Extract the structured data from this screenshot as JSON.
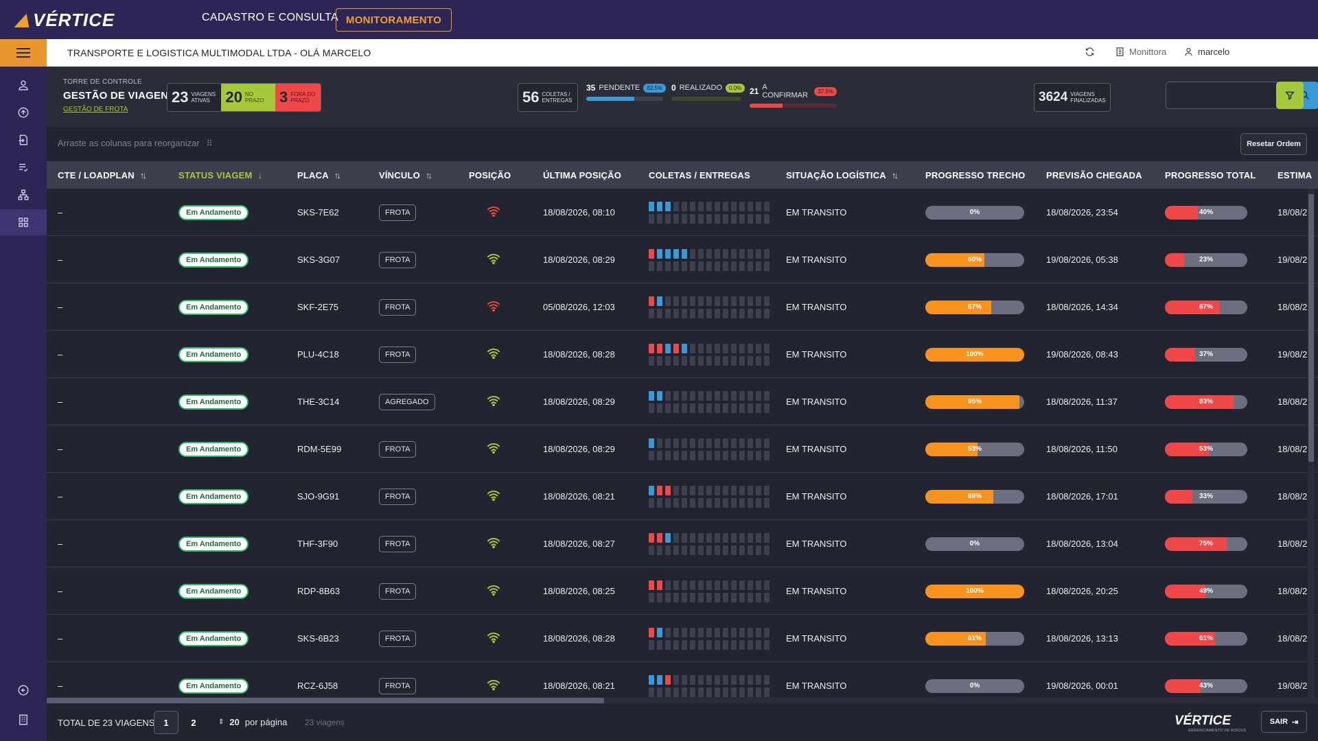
{
  "app": {
    "logo": "VÉRTICE",
    "nav_cadastro": "CADASTRO E CONSULTA",
    "nav_monitoramento": "MONITORAMENTO",
    "company_line": "TRANSPORTE E LOGISTICA MULTIMODAL LTDA - OLÁ MARCELO",
    "monittora": "Monittora",
    "user": "marcelo",
    "footer_logo": "VÉRTICE",
    "footer_logo_sub": "GERENCIAMENTO DE RISCOS"
  },
  "header": {
    "tower_small": "TORRE DE CONTROLE",
    "tower_title": "GESTÃO DE VIAGENS",
    "tower_link": "GESTÃO DE FROTA"
  },
  "kpis": {
    "ativas_num": "23",
    "ativas_lbl": "VIAGENS ATIVAS",
    "prazo_num": "20",
    "prazo_lbl": "NO PRAZO",
    "fora_num": "3",
    "fora_lbl": "FORA DO PRAZO",
    "coletas_num": "56",
    "coletas_lbl": "COLETAS / ENTREGAS",
    "pendente_num": "35",
    "pendente_lbl": "PENDENTE",
    "pendente_pct": "62.5%",
    "pendente_frac": 0.625,
    "realizado_num": "0",
    "realizado_lbl": "REALIZADO",
    "realizado_pct": "0.0%",
    "realizado_frac": 0,
    "confirmar_num": "21",
    "confirmar_lbl": "A CONFIRMAR",
    "confirmar_pct": "37.5%",
    "confirmar_frac": 0.375,
    "finalizadas_num": "3624",
    "finalizadas_lbl": "VIAGENS FINALIZADAS"
  },
  "toolbar": {
    "hint": "Arraste as colunas para reorganizar",
    "reset": "Resetar Ordem"
  },
  "columns": {
    "cte": "CTE / LOADPLAN",
    "status": "STATUS VIAGEM",
    "placa": "PLACA",
    "vinculo": "VÍNCULO",
    "posicao": "POSIÇÃO",
    "ultima": "ÚLTIMA POSIÇÃO",
    "coletas": "COLETAS / ENTREGAS",
    "situacao": "SITUAÇÃO LOGÍSTICA",
    "trecho": "PROGRESSO TRECHO",
    "previsao": "PREVISÃO CHEGADA",
    "total": "PROGRESSO TOTAL",
    "estima": "ESTIMA"
  },
  "colors": {
    "orange": "#f7931e",
    "red": "#f04848",
    "blue": "#3a9ad9",
    "green_wifi": "#a5c93a",
    "red_wifi": "#e8483f"
  },
  "rows": [
    {
      "cte": "–",
      "status": "Em Andamento",
      "placa": "SKS-7E62",
      "vinculo": "FROTA",
      "signal": "red",
      "ultima": "18/08/2026, 08:10",
      "blocks": [
        "b",
        "b",
        "b"
      ],
      "situacao": "EM TRANSITO",
      "trecho_pct": "0%",
      "trecho": 0,
      "previsao": "18/08/2026, 23:54",
      "total_pct": "40%",
      "total": 0.4,
      "estima": "18/08/2"
    },
    {
      "cte": "–",
      "status": "Em Andamento",
      "placa": "SKS-3G07",
      "vinculo": "FROTA",
      "signal": "green",
      "ultima": "18/08/2026, 08:29",
      "blocks": [
        "r",
        "b",
        "b",
        "b",
        "b"
      ],
      "situacao": "EM TRANSITO",
      "trecho_pct": "60%",
      "trecho": 0.6,
      "previsao": "19/08/2026, 05:38",
      "total_pct": "23%",
      "total": 0.23,
      "estima": "19/08/2"
    },
    {
      "cte": "–",
      "status": "Em Andamento",
      "placa": "SKF-2E75",
      "vinculo": "FROTA",
      "signal": "red",
      "ultima": "05/08/2026, 12:03",
      "blocks": [
        "r",
        "b"
      ],
      "situacao": "EM TRANSITO",
      "trecho_pct": "67%",
      "trecho": 0.67,
      "previsao": "18/08/2026, 14:34",
      "total_pct": "67%",
      "total": 0.67,
      "estima": "18/08/2"
    },
    {
      "cte": "–",
      "status": "Em Andamento",
      "placa": "PLU-4C18",
      "vinculo": "FROTA",
      "signal": "green",
      "ultima": "18/08/2026, 08:28",
      "blocks": [
        "r",
        "r",
        "b",
        "r",
        "b"
      ],
      "situacao": "EM TRANSITO",
      "trecho_pct": "100%",
      "trecho": 1.0,
      "previsao": "19/08/2026, 08:43",
      "total_pct": "37%",
      "total": 0.37,
      "estima": "19/08/2"
    },
    {
      "cte": "–",
      "status": "Em Andamento",
      "placa": "THE-3C14",
      "vinculo": "AGREGADO",
      "signal": "green",
      "ultima": "18/08/2026, 08:29",
      "blocks": [
        "b",
        "b"
      ],
      "situacao": "EM TRANSITO",
      "trecho_pct": "95%",
      "trecho": 0.95,
      "previsao": "18/08/2026, 11:37",
      "total_pct": "83%",
      "total": 0.83,
      "estima": "18/08/2"
    },
    {
      "cte": "–",
      "status": "Em Andamento",
      "placa": "RDM-5E99",
      "vinculo": "FROTA",
      "signal": "green",
      "ultima": "18/08/2026, 08:29",
      "blocks": [
        "b"
      ],
      "situacao": "EM TRANSITO",
      "trecho_pct": "53%",
      "trecho": 0.53,
      "previsao": "18/08/2026, 11:50",
      "total_pct": "53%",
      "total": 0.53,
      "estima": "18/08/2"
    },
    {
      "cte": "–",
      "status": "Em Andamento",
      "placa": "SJO-9G91",
      "vinculo": "FROTA",
      "signal": "green",
      "ultima": "18/08/2026, 08:21",
      "blocks": [
        "b",
        "r",
        "r"
      ],
      "situacao": "EM TRANSITO",
      "trecho_pct": "69%",
      "trecho": 0.69,
      "previsao": "18/08/2026, 17:01",
      "total_pct": "33%",
      "total": 0.33,
      "estima": "18/08/2"
    },
    {
      "cte": "–",
      "status": "Em Andamento",
      "placa": "THF-3F90",
      "vinculo": "FROTA",
      "signal": "green",
      "ultima": "18/08/2026, 08:27",
      "blocks": [
        "r",
        "r",
        "b"
      ],
      "situacao": "EM TRANSITO",
      "trecho_pct": "0%",
      "trecho": 0,
      "previsao": "18/08/2026, 13:04",
      "total_pct": "75%",
      "total": 0.75,
      "estima": "18/08/2"
    },
    {
      "cte": "–",
      "status": "Em Andamento",
      "placa": "RDP-8B63",
      "vinculo": "FROTA",
      "signal": "green",
      "ultima": "18/08/2026, 08:25",
      "blocks": [
        "r",
        "r"
      ],
      "situacao": "EM TRANSITO",
      "trecho_pct": "100%",
      "trecho": 1.0,
      "previsao": "18/08/2026, 20:25",
      "total_pct": "49%",
      "total": 0.49,
      "estima": "18/08/2"
    },
    {
      "cte": "–",
      "status": "Em Andamento",
      "placa": "SKS-6B23",
      "vinculo": "FROTA",
      "signal": "green",
      "ultima": "18/08/2026, 08:28",
      "blocks": [
        "r",
        "b"
      ],
      "situacao": "EM TRANSITO",
      "trecho_pct": "61%",
      "trecho": 0.61,
      "previsao": "18/08/2026, 13:13",
      "total_pct": "61%",
      "total": 0.61,
      "estima": "18/08/2"
    },
    {
      "cte": "–",
      "status": "Em Andamento",
      "placa": "RCZ-6J58",
      "vinculo": "FROTA",
      "signal": "green",
      "ultima": "18/08/2026, 08:21",
      "blocks": [
        "b",
        "b",
        "r"
      ],
      "situacao": "EM TRANSITO",
      "trecho_pct": "0%",
      "trecho": 0,
      "previsao": "19/08/2026, 00:01",
      "total_pct": "43%",
      "total": 0.43,
      "estima": "19/08/2"
    }
  ],
  "footer": {
    "total": "TOTAL DE 23 VIAGENS",
    "page1": "1",
    "page2": "2",
    "per_page_num": "20",
    "per_page_lbl": "por página",
    "count": "23 viagens",
    "exit": "SAIR"
  }
}
